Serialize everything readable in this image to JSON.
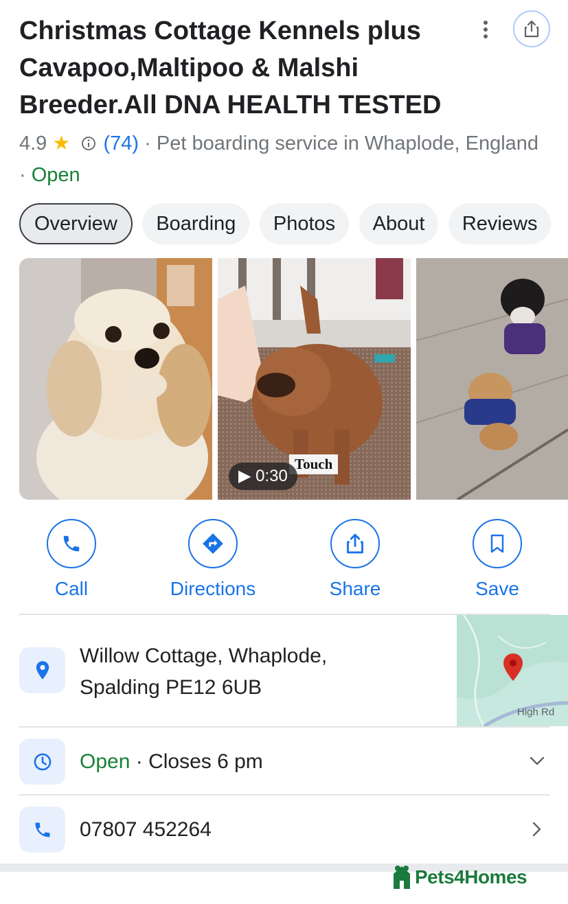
{
  "header": {
    "title": "Christmas Cottage Kennels plus Cavapoo,Maltipoo & Malshi Breeder.All DNA HEALTH TESTED",
    "more_icon": "more-vert-icon",
    "share_icon": "share-icon"
  },
  "meta": {
    "rating": "4.9",
    "reviews": "(74)",
    "sep": " · ",
    "category": "Pet boarding service in Whaplode, England",
    "status": "Open"
  },
  "tabs": [
    {
      "label": "Overview",
      "active": true
    },
    {
      "label": "Boarding"
    },
    {
      "label": "Photos"
    },
    {
      "label": "About"
    },
    {
      "label": "Reviews"
    }
  ],
  "photos": {
    "video_duration": "▶ 0:30",
    "overlay_text": "Touch"
  },
  "actions": [
    {
      "label": "Call",
      "icon": "phone-icon"
    },
    {
      "label": "Directions",
      "icon": "directions-icon"
    },
    {
      "label": "Share",
      "icon": "share-icon"
    },
    {
      "label": "Save",
      "icon": "bookmark-icon"
    }
  ],
  "address": {
    "line1": "Willow Cottage, Whaplode,",
    "line2": "Spalding PE12 6UB",
    "map_road_label": "High Rd"
  },
  "hours": {
    "status": "Open",
    "sep": " · ",
    "closes": "Closes 6 pm"
  },
  "phone": {
    "number": "07807 452264"
  },
  "watermark": {
    "brand": "Pets4Homes"
  },
  "colors": {
    "accent": "#1a73e8",
    "open": "#188038",
    "star": "#fbbc04",
    "brand": "#1b7a3d"
  }
}
